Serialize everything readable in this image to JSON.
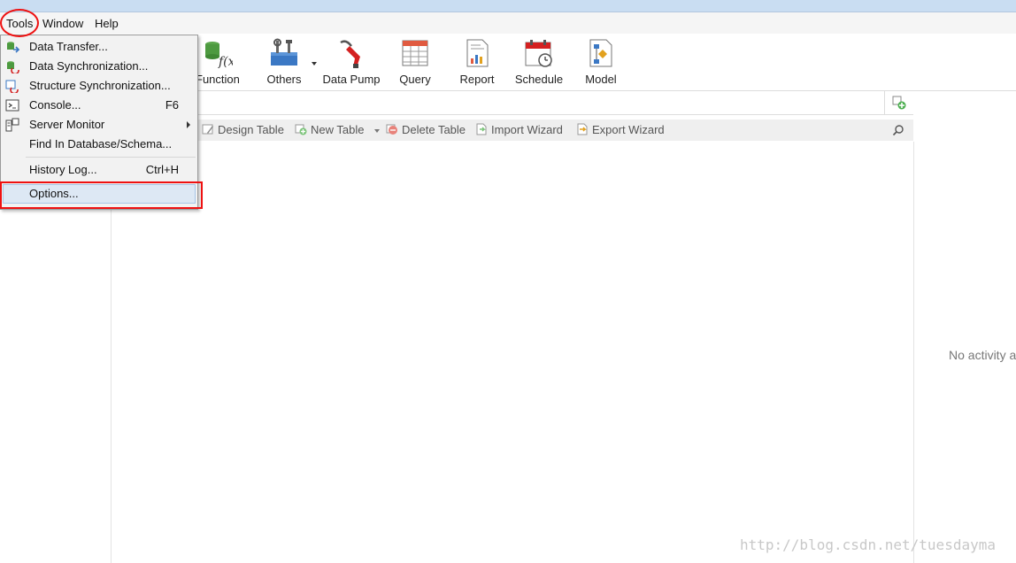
{
  "menubar": {
    "items": [
      "Tools",
      "Window",
      "Help"
    ]
  },
  "toolbar": {
    "buttons": [
      {
        "label": "Function",
        "icon": "function-icon"
      },
      {
        "label": "Others",
        "icon": "others-icon"
      },
      {
        "label": "Data Pump",
        "icon": "data-pump-icon"
      },
      {
        "label": "Query",
        "icon": "query-icon"
      },
      {
        "label": "Report",
        "icon": "report-icon"
      },
      {
        "label": "Schedule",
        "icon": "schedule-icon"
      },
      {
        "label": "Model",
        "icon": "model-icon"
      }
    ]
  },
  "object_toolbar": {
    "design_table": "Design Table",
    "new_table": "New Table",
    "delete_table": "Delete Table",
    "import_wizard": "Import Wizard",
    "export_wizard": "Export Wizard"
  },
  "tools_menu": {
    "items": [
      {
        "label": "Data Transfer...",
        "shortcut": ""
      },
      {
        "label": "Data Synchronization...",
        "shortcut": ""
      },
      {
        "label": "Structure Synchronization...",
        "shortcut": ""
      },
      {
        "label": "Console...",
        "shortcut": "F6"
      },
      {
        "label": "Server Monitor",
        "shortcut": ""
      },
      {
        "label": "Find In Database/Schema...",
        "shortcut": ""
      },
      {
        "label": "History Log...",
        "shortcut": "Ctrl+H"
      },
      {
        "label": "Options...",
        "shortcut": ""
      }
    ]
  },
  "right_pane": {
    "message": "No activity a"
  },
  "watermark": "http://blog.csdn.net/tuesdayma",
  "colors": {
    "highlight": "#e11111",
    "titlebar": "#c9ddf2"
  }
}
